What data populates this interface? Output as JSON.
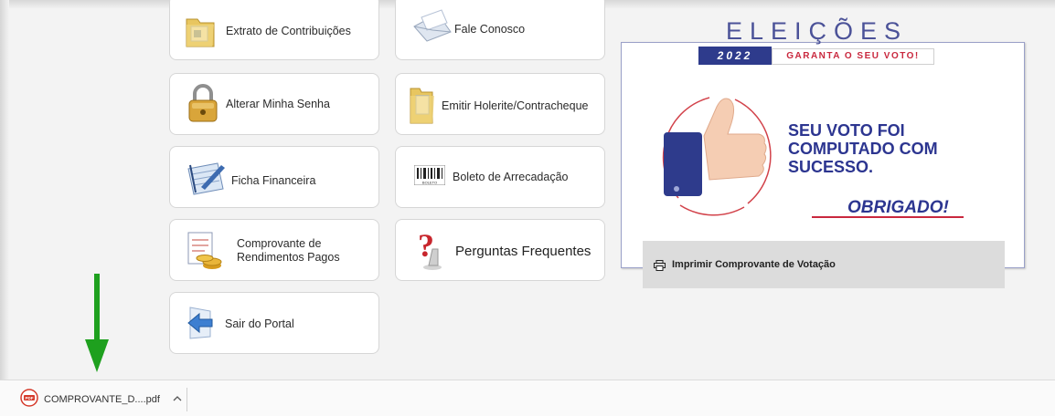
{
  "cards": {
    "extrato": "Extrato de Contribuições",
    "fale": "Fale Conosco",
    "alterar": "Alterar Minha Senha",
    "holerite": "Emitir Holerite/Contracheque",
    "ficha": "Ficha Financeira",
    "boleto": "Boleto de Arrecadação",
    "boleto_icon_text": "BOLETO",
    "comprovante_line1": "Comprovante de",
    "comprovante_line2": "Rendimentos Pagos",
    "perguntas": "Perguntas Frequentes",
    "sair": "Sair do Portal"
  },
  "election": {
    "word": "ELEIÇÕES",
    "year": "2022",
    "tagline": "GARANTA O SEU VOTO!",
    "message_line1": "SEU VOTO FOI",
    "message_line2": "COMPUTADO COM",
    "message_line3": "SUCESSO.",
    "thanks": "OBRIGADO!",
    "print_label": "Imprimir Comprovante de Votação"
  },
  "downloads": {
    "filename": "COMPROVANTE_D....pdf",
    "file_badge": "PDF"
  },
  "colors": {
    "election_blue": "#2c3590",
    "election_red": "#c9283e",
    "arrow_green": "#1ea01e"
  },
  "icons": {
    "extrato": "folder-document-icon",
    "fale": "envelope-icon",
    "alterar": "padlock-icon",
    "holerite": "folder-icon",
    "ficha": "notepad-pen-icon",
    "boleto": "barcode-icon",
    "comprovante": "coins-document-icon",
    "perguntas": "question-mark-icon",
    "sair": "back-arrow-icon",
    "print": "printer-icon",
    "download": "pdf-file-icon",
    "chevron": "chevron-up-icon"
  }
}
